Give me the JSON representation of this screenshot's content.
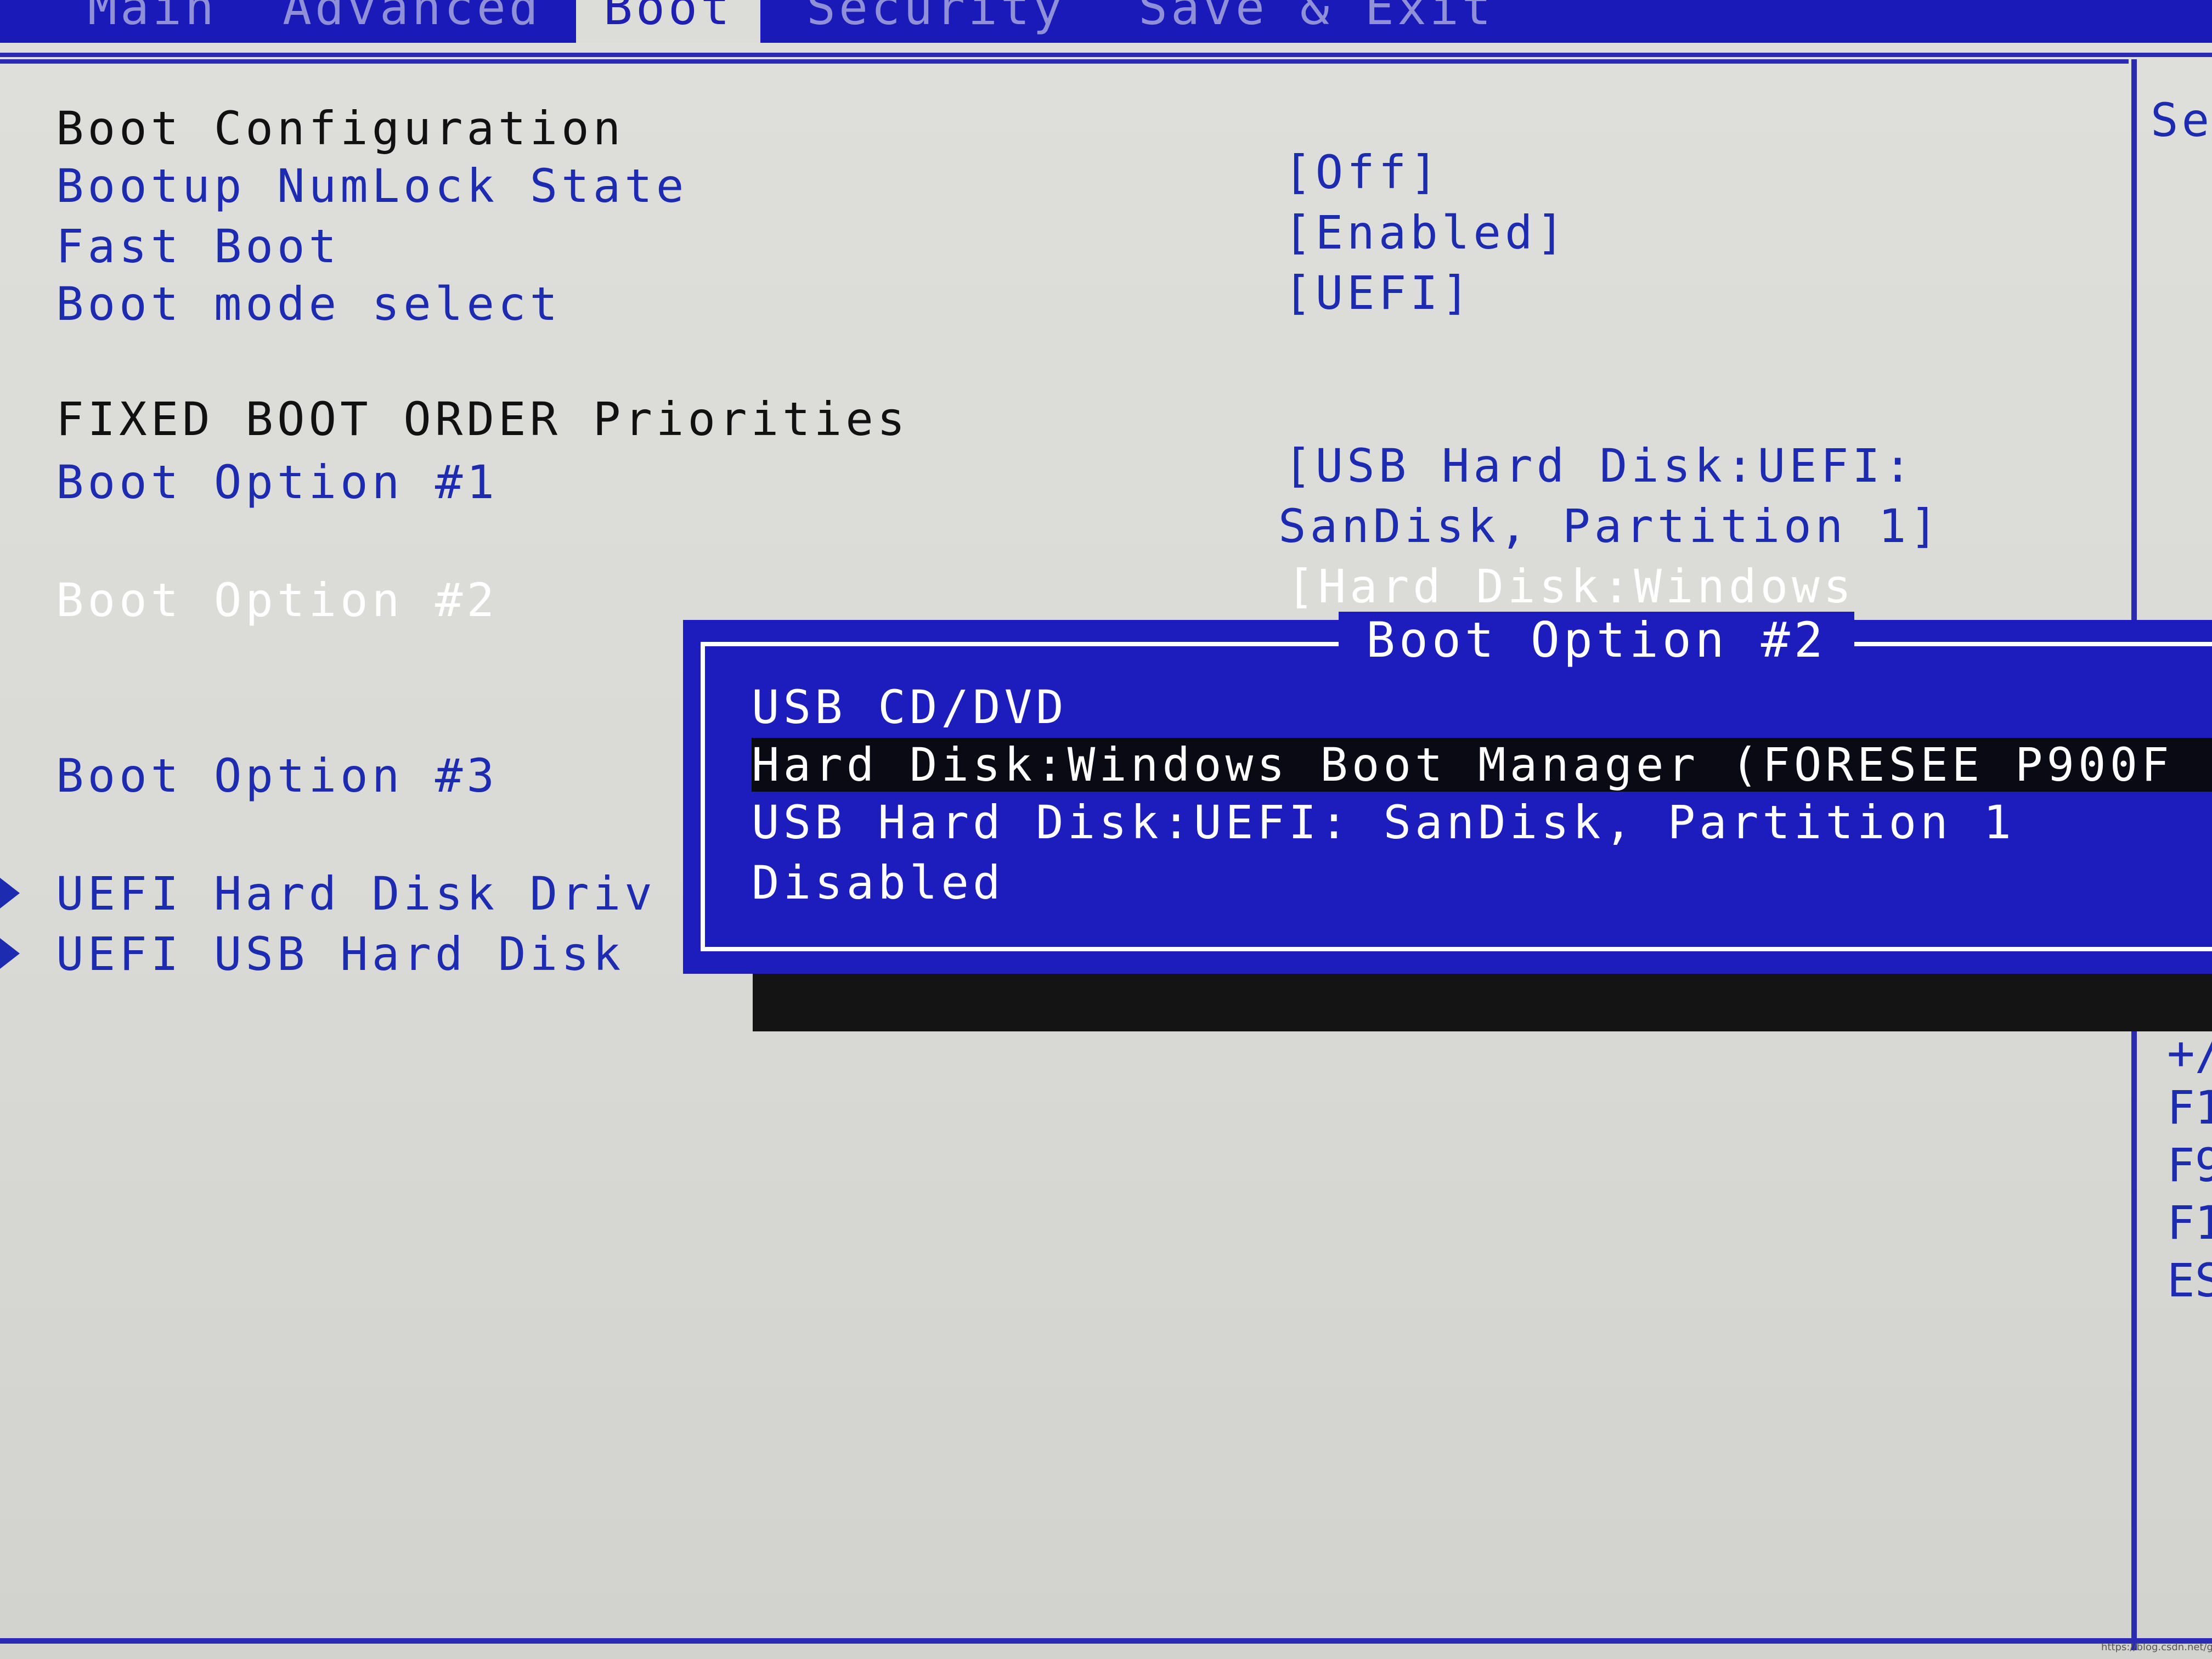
{
  "menu": {
    "tabs": [
      {
        "label": "Main"
      },
      {
        "label": "Advanced"
      },
      {
        "label": "Boot"
      },
      {
        "label": "Security"
      },
      {
        "label": "Save & Exit"
      }
    ],
    "active_tab": "Boot"
  },
  "boot_configuration": {
    "heading": "Boot Configuration",
    "items": [
      {
        "label": "Bootup NumLock State",
        "value": "[Off]"
      },
      {
        "label": "Fast Boot",
        "value": "[Enabled]"
      },
      {
        "label": "Boot mode select",
        "value": "[UEFI]"
      }
    ]
  },
  "fixed_boot_order": {
    "heading": "FIXED BOOT ORDER Priorities",
    "options": [
      {
        "label": "Boot Option #1",
        "value_line1": "[USB Hard Disk:UEFI:",
        "value_line2": "SanDisk, Partition 1]"
      },
      {
        "label": "Boot Option #2",
        "value_line1": "[Hard Disk:Windows",
        "value_line2": ""
      },
      {
        "label": "Boot Option #3",
        "value_line1": "",
        "value_line2": ""
      }
    ]
  },
  "submenus": [
    {
      "label": "UEFI Hard Disk Driv"
    },
    {
      "label": "UEFI USB Hard Disk"
    }
  ],
  "help_panel": {
    "title": "Se",
    "keys": [
      "+/",
      "F1",
      "F9",
      "F1",
      "ES"
    ]
  },
  "popup": {
    "title": "Boot Option #2",
    "items": [
      {
        "label": "USB CD/DVD",
        "highlighted": false
      },
      {
        "label": "Hard Disk:Windows Boot Manager (FORESEE P900F",
        "highlighted": true
      },
      {
        "label": "USB Hard Disk:UEFI: SanDisk, Partition 1",
        "highlighted": false
      },
      {
        "label": "Disabled",
        "highlighted": false
      }
    ]
  },
  "watermark": "https://blog.csdn.net/gy..."
}
